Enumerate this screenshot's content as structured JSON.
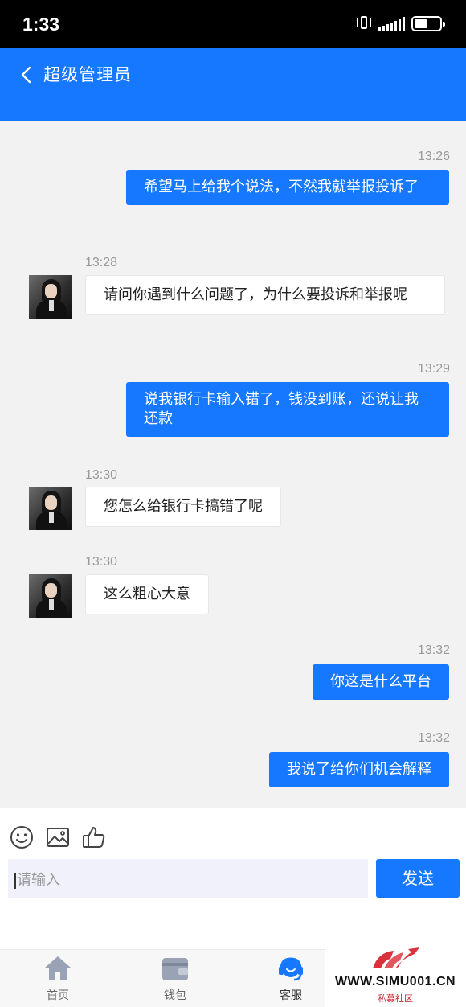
{
  "status_bar": {
    "time": "1:33"
  },
  "header": {
    "title": "超级管理员"
  },
  "messages": [
    {
      "side": "sent",
      "time": "13:26",
      "text": "希望马上给我个说法，不然我就举报投诉了"
    },
    {
      "side": "received",
      "time": "13:28",
      "text": "请问你遇到什么问题了，为什么要投诉和举报呢"
    },
    {
      "side": "sent",
      "time": "13:29",
      "text": "说我银行卡输入错了，钱没到账，还说让我还款"
    },
    {
      "side": "received",
      "time": "13:30",
      "text": "您怎么给银行卡搞错了呢"
    },
    {
      "side": "received",
      "time": "13:30",
      "text": "这么粗心大意"
    },
    {
      "side": "sent",
      "time": "13:32",
      "text": "你这是什么平台"
    },
    {
      "side": "sent",
      "time": "13:32",
      "text": "我说了给你们机会解释"
    }
  ],
  "composer": {
    "tools": [
      "emoji-icon",
      "image-icon",
      "thumbs-up-icon"
    ],
    "input_placeholder": "请输入",
    "send_label": "发送"
  },
  "tabbar": {
    "tabs": [
      {
        "label": "首页",
        "icon": "home-icon"
      },
      {
        "label": "钱包",
        "icon": "wallet-icon"
      },
      {
        "label": "客服",
        "icon": "customer-service-icon",
        "active": true
      }
    ]
  },
  "watermark": {
    "url": "WWW.SIMU001.CN",
    "subtitle": "私募社区"
  },
  "colors": {
    "primary": "#1677ff",
    "background": "#f2f2f2",
    "watermark_red": "#d9323c"
  }
}
